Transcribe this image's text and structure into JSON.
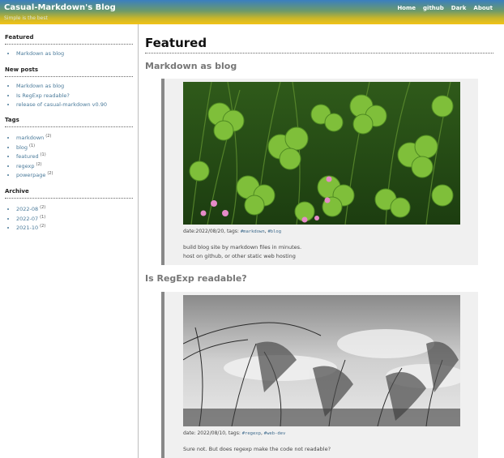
{
  "header": {
    "title": "Casual-Markdown's Blog",
    "subtitle": "Simple is the best",
    "nav": [
      "Home",
      "github",
      "Dark",
      "About"
    ]
  },
  "sidebar": {
    "featured": {
      "heading": "Featured",
      "items": [
        "Markdown as blog"
      ]
    },
    "new_posts": {
      "heading": "New posts",
      "items": [
        "Markdown as blog",
        "Is RegExp readable?",
        "release of casual-markdown v0.90"
      ]
    },
    "tags": {
      "heading": "Tags",
      "items": [
        {
          "label": "markdown",
          "count": "(2)"
        },
        {
          "label": "blog",
          "count": "(1)"
        },
        {
          "label": "featured",
          "count": "(1)"
        },
        {
          "label": "regexp",
          "count": "(2)"
        },
        {
          "label": "powerpage",
          "count": "(2)"
        }
      ]
    },
    "archive": {
      "heading": "Archive",
      "items": [
        {
          "label": "2022-08",
          "count": "(2)"
        },
        {
          "label": "2022-07",
          "count": "(1)"
        },
        {
          "label": "2021-10",
          "count": "(2)"
        }
      ]
    }
  },
  "main": {
    "page_title": "Featured",
    "posts": [
      {
        "title": "Markdown as blog",
        "meta_prefix": "date:2022/08/20, tags: ",
        "tags": [
          "#markdown",
          "#blog"
        ],
        "lines": [
          "build blog site by markdown files in minutes.",
          "host on github, or other static web hosting"
        ],
        "image": "green-clover-plants-with-pink-flowers"
      },
      {
        "title": "Is RegExp readable?",
        "meta_prefix": "date: 2022/08/10, tags: ",
        "tags": [
          "#regexp",
          "#web-dev"
        ],
        "lines": [
          "Sure not. But does regexp make the code not readable?"
        ],
        "image": "grayscale-pampas-grass-under-sky"
      }
    ]
  }
}
